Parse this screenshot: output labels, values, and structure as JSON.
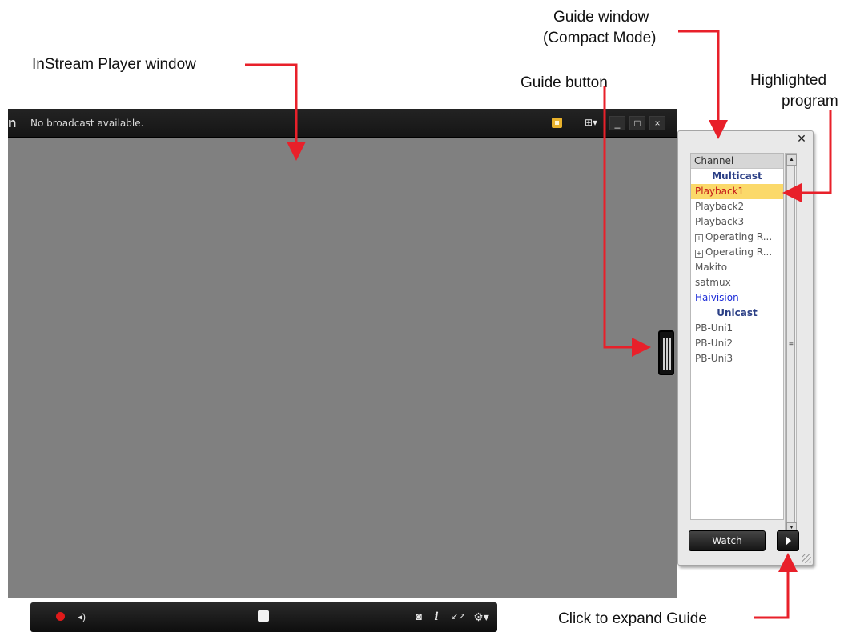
{
  "callouts": {
    "player_window": "InStream Player window",
    "guide_window_line1": "Guide window",
    "guide_window_line2": "(Compact Mode)",
    "guide_button": "Guide button",
    "highlighted_line1": "Highlighted",
    "highlighted_line2": "program",
    "click_expand": "Click to expand Guide"
  },
  "player": {
    "logo_fragment": "n",
    "status": "No broadcast available.",
    "layout_icon": "⊞▾",
    "minimize_icon": "_",
    "maximize_icon": "□",
    "close_icon": "×"
  },
  "controls": {
    "volume_icon": "◂)",
    "snapshot_icon": "◙",
    "info_icon": "i",
    "fullscreen_icon": "↙↗",
    "settings_icon": "⚙▾"
  },
  "guide": {
    "close_icon": "✕",
    "column_header": "Channel",
    "groups": {
      "multicast": "Multicast",
      "unicast": "Unicast"
    },
    "multicast_items": [
      "Playback1",
      "Playback2",
      "Playback3"
    ],
    "operating_items": [
      "Operating R...",
      "Operating R..."
    ],
    "multicast_items_2": [
      "Makito",
      "satmux"
    ],
    "link_item": "Haivision",
    "unicast_items": [
      "PB-Uni1",
      "PB-Uni2",
      "PB-Uni3"
    ],
    "watch_label": "Watch",
    "scroll_up": "▲",
    "scroll_down": "▼",
    "scroll_grip": "≡"
  },
  "colors": {
    "highlight_bg": "#fbd96a",
    "highlight_text": "#c41818",
    "arrow": "#e8202a",
    "video_bg": "#808080"
  }
}
